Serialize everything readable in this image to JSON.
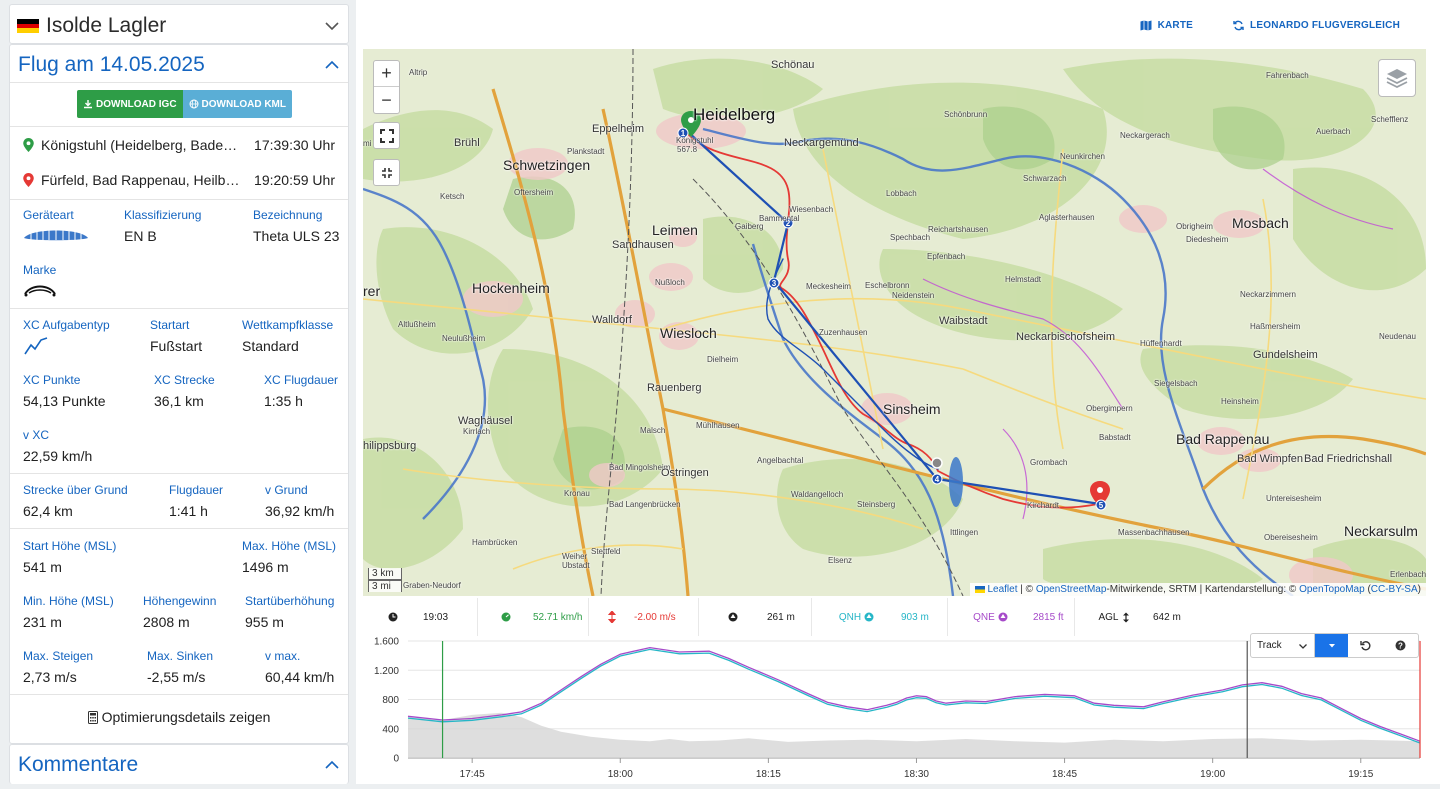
{
  "pilot": {
    "name": "Isolde Lagler",
    "flag_colors": [
      "#000000",
      "#dd0000",
      "#ffce00"
    ]
  },
  "flight": {
    "title": "Flug am 14.05.2025",
    "download_igc": "DOWNLOAD IGC",
    "download_kml": "DOWNLOAD KML",
    "takeoff": {
      "place": "Königstuhl (Heidelberg, Baden-Württemberg)",
      "time": "17:39:30 Uhr"
    },
    "landing": {
      "place": "Fürfeld, Bad Rappenau, Heilbronn",
      "time": "19:20:59 Uhr"
    },
    "stats": {
      "geraeteart_label": "Geräteart",
      "klassifizierung_label": "Klassifizierung",
      "klassifizierung": "EN B",
      "bezeichnung_label": "Bezeichnung",
      "bezeichnung": "Theta ULS 23",
      "marke_label": "Marke",
      "xc_aufgabentyp_label": "XC Aufgabentyp",
      "startart_label": "Startart",
      "startart": "Fußstart",
      "wettkampfklasse_label": "Wettkampfklasse",
      "wettkampfklasse": "Standard",
      "xc_punkte_label": "XC Punkte",
      "xc_punkte": "54,13 Punkte",
      "xc_strecke_label": "XC Strecke",
      "xc_strecke": "36,1 km",
      "xc_flugdauer_label": "XC Flugdauer",
      "xc_flugdauer": "1:35 h",
      "v_xc_label": "v XC",
      "v_xc": "22,59 km/h",
      "strecke_grund_label": "Strecke über Grund",
      "strecke_grund": "62,4 km",
      "flugdauer_label": "Flugdauer",
      "flugdauer": "1:41 h",
      "v_grund_label": "v Grund",
      "v_grund": "36,92 km/h",
      "start_hoehe_label": "Start Höhe (MSL)",
      "start_hoehe": "541 m",
      "max_hoehe_label": "Max. Höhe (MSL)",
      "max_hoehe": "1496 m",
      "min_hoehe_label": "Min. Höhe (MSL)",
      "min_hoehe": "231 m",
      "hoehengewinn_label": "Höhengewinn",
      "hoehengewinn": "2808 m",
      "startueberhoehung_label": "Startüberhöhung",
      "startueberhoehung": "955 m",
      "max_steigen_label": "Max. Steigen",
      "max_steigen": "2,73 m/s",
      "max_sinken_label": "Max. Sinken",
      "max_sinken": "-2,55 m/s",
      "v_max_label": "v max.",
      "v_max": "60,44 km/h"
    },
    "optimization_link": "Optimierungsdetails zeigen"
  },
  "comments": {
    "title": "Kommentare"
  },
  "top_links": {
    "karte": "KARTE",
    "leonardo": "LEONARDO FLUGVERGLEICH"
  },
  "map": {
    "zoom_in": "+",
    "zoom_out": "−",
    "scale_km": "3 km",
    "scale_mi": "3 mi",
    "attribution": {
      "leaflet": "Leaflet",
      "text1": " | © ",
      "osm": "OpenStreetMap",
      "text2": "-Mitwirkende, SRTM | Kartendarstellung: © ",
      "otm": "OpenTopoMap",
      "text3": " (",
      "cc": "CC-BY-SA",
      "text4": ")"
    },
    "places": {
      "heidelberg": "Heidelberg",
      "koenigstuhl": "Königstuhl",
      "koenigstuhl_alt": "567.8",
      "schoenau": "Schönau",
      "eppelheim": "Eppelheim",
      "bruehl": "Brühl",
      "altrip": "Altrip",
      "plankstadt": "Plankstadt",
      "schwetzingen": "Schwetzingen",
      "neckargemuend": "Neckargemünd",
      "schoenbrunn": "Schönbrunn",
      "fahrenbach": "Fahrenbach",
      "neckargerach": "Neckargerach",
      "auerbach": "Auerbach",
      "schefflenz": "Schefflenz",
      "neunkirchen": "Neunkirchen",
      "schwarzach": "Schwarzach",
      "aglasterhausen": "Aglasterhausen",
      "obrigheim": "Obrigheim",
      "mosbach": "Mosbach",
      "diedesheim": "Diedesheim",
      "ketsch": "Ketsch",
      "oftersheim": "Oftersheim",
      "wiesenbach": "Wiesenbach",
      "gaiberg": "Gaiberg",
      "bammental": "Bammental",
      "lobbach": "Lobbach",
      "leimen": "Leimen",
      "sandhausen": "Sandhausen",
      "spechbach": "Spechbach",
      "reichartshausen": "Reichartshausen",
      "epfenbach": "Epfenbach",
      "helmstadt": "Helmstadt",
      "hockenheim": "Hockenheim",
      "nussloch": "Nußloch",
      "meckesheim": "Meckesheim",
      "eschelbronn": "Eschelbronn",
      "neidenstein": "Neidenstein",
      "neckarzimmern": "Neckarzimmern",
      "walldorf": "Walldorf",
      "wiesloch": "Wiesloch",
      "zuzenhausen": "Zuzenhausen",
      "waibstadt": "Waibstadt",
      "neckarbischofsheim": "Neckarbischofsheim",
      "hassmersheim": "Haßmersheim",
      "neudenau": "Neudenau",
      "huffenhardt": "Hüffenhardt",
      "gundelsheim": "Gundelsheim",
      "altlussheim": "Altlußheim",
      "neulussheim": "Neulußheim",
      "dielheim": "Dielheim",
      "siegelsbach": "Siegelsbach",
      "rauenberg": "Rauenberg",
      "sinsheim": "Sinsheim",
      "obergimpern": "Obergimpern",
      "heinsheim": "Heinsheim",
      "waghaeusel": "Waghäusel",
      "kirrlach": "Kirrlach",
      "malsch": "Malsch",
      "muehlhausen": "Mühlhausen",
      "babstadt": "Babstadt",
      "bad_rappenau": "Bad Rappenau",
      "philippsburg": "hilippsburg",
      "bad_mingolsheim": "Bad Mingolsheim",
      "oestringen": "Östringen",
      "angelbachtal": "Angelbachtal",
      "grombach": "Grombach",
      "bad_wimpfen": "Bad Wimpfen",
      "bad_friedrichshall": "Bad Friedrichshall",
      "kronau": "Kronau",
      "bad_langenbruecken": "Bad Langenbrücken",
      "waldangelloch": "Waldangelloch",
      "steinsberg": "Steinsberg",
      "kirchardt": "Kirchardt",
      "untereisesheim": "Untereisesheim",
      "hambruecken": "Hambrücken",
      "stettfeld": "Stettfeld",
      "ittlingen": "Ittlingen",
      "massenbachhausen": "Massenbachhausen",
      "obereisesheim": "Obereisesheim",
      "neckarsulm": "Neckarsulm",
      "weiher": "Weiher",
      "ubstadt": "Ubstadt",
      "elsenz": "Elsenz",
      "graben_neudorf": "Graben-Neudorf",
      "erlenbach": "Erlenbach",
      "rer": "rer",
      "mi": "mi"
    },
    "waypoints": [
      "1",
      "2",
      "3",
      "4",
      "5"
    ],
    "track_colors": {
      "gps": "#e53935",
      "optimized": "#1e50b4",
      "launch": "#2e9d47",
      "landing": "#e53935"
    }
  },
  "status": {
    "time": "19:03",
    "speed": "52.71 km/h",
    "vario": "-2.00 m/s",
    "altitude": "261 m",
    "qnh_label": "QNH",
    "qnh": "903 m",
    "qne_label": "QNE",
    "qne": "2815 ft",
    "agl_label": "AGL",
    "agl": "642 m",
    "colors": {
      "speed": "#2e9d47",
      "vario": "#e53935",
      "qnh": "#26b6c7",
      "qne": "#a64ac9"
    }
  },
  "chart_controls": {
    "mode": "Track"
  },
  "chart_data": {
    "type": "area",
    "y_ticks": [
      "1.600",
      "1.200",
      "800",
      "400",
      "0"
    ],
    "x_ticks": [
      "17:45",
      "18:00",
      "18:15",
      "18:30",
      "18:45",
      "19:00",
      "19:15"
    ],
    "ylim": [
      0,
      1600
    ],
    "xlim_min": [
      -6.5,
      96
    ],
    "series": [
      {
        "name": "QNE",
        "color": "#a64ac9",
        "x": [
          -6.5,
          -3,
          0,
          3,
          5,
          7,
          9,
          11,
          13,
          15,
          18,
          21,
          24,
          26,
          28,
          31,
          34,
          36,
          38,
          40,
          42,
          43,
          44,
          45,
          46,
          47,
          48,
          50,
          52,
          55,
          58,
          61,
          63,
          65,
          68,
          70,
          73,
          76,
          78,
          80,
          82,
          84,
          86,
          88,
          90,
          92,
          94,
          96
        ],
        "y": [
          570,
          520,
          540,
          590,
          630,
          750,
          930,
          1110,
          1280,
          1420,
          1510,
          1450,
          1460,
          1360,
          1240,
          1070,
          880,
          760,
          700,
          660,
          720,
          760,
          820,
          850,
          840,
          780,
          750,
          780,
          770,
          840,
          870,
          850,
          750,
          720,
          700,
          770,
          860,
          930,
          1000,
          1030,
          980,
          880,
          820,
          680,
          540,
          430,
          330,
          230
        ]
      },
      {
        "name": "QNH",
        "color": "#26b6c7",
        "x": [
          -6.5,
          -3,
          0,
          3,
          5,
          7,
          9,
          11,
          13,
          15,
          18,
          21,
          24,
          26,
          28,
          31,
          34,
          36,
          38,
          40,
          42,
          43,
          44,
          45,
          46,
          47,
          48,
          50,
          52,
          55,
          58,
          61,
          63,
          65,
          68,
          70,
          73,
          76,
          78,
          80,
          82,
          84,
          86,
          88,
          90,
          92,
          94,
          96
        ],
        "y": [
          545,
          495,
          515,
          565,
          605,
          725,
          905,
          1085,
          1255,
          1395,
          1485,
          1425,
          1435,
          1335,
          1215,
          1045,
          855,
          735,
          675,
          635,
          695,
          735,
          795,
          825,
          815,
          755,
          725,
          755,
          745,
          815,
          845,
          825,
          725,
          695,
          675,
          745,
          835,
          905,
          975,
          1005,
          955,
          855,
          795,
          655,
          515,
          405,
          305,
          205
        ]
      },
      {
        "name": "Terrain",
        "color": "#d3d3d3",
        "x": [
          -6.5,
          -3,
          0,
          3,
          5,
          7,
          9,
          12,
          15,
          18,
          20,
          22,
          25,
          28,
          32,
          36,
          40,
          45,
          50,
          55,
          60,
          65,
          70,
          75,
          80,
          85,
          90,
          96
        ],
        "y": [
          560,
          520,
          590,
          620,
          560,
          440,
          360,
          290,
          250,
          230,
          260,
          230,
          240,
          270,
          220,
          240,
          250,
          230,
          260,
          230,
          210,
          250,
          230,
          260,
          270,
          240,
          250,
          230
        ]
      }
    ]
  }
}
